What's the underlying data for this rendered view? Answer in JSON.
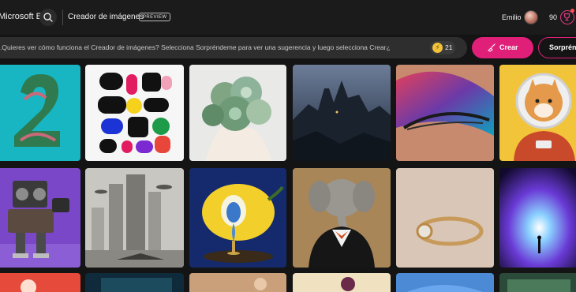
{
  "header": {
    "brand": "Microsoft Bing",
    "search_icon": "search-icon",
    "app_title": "Creador de imágenes",
    "badge": "PREVIEW",
    "user_name": "Emilio",
    "points": "90",
    "rewards_icon": "rewards-trophy-icon"
  },
  "prompt": {
    "placeholder": "¿Quieres ver cómo funciona el Creador de imágenes? Selecciona Sorpréndeme para ver una sugerencia y luego selecciona Crear.",
    "boosts": "21",
    "boost_icon": "boost-bolt-icon"
  },
  "actions": {
    "create_label": "Crear",
    "create_icon": "brush-icon",
    "surprise_label": "Sorpréndeme"
  },
  "colors": {
    "accent": "#e01f79",
    "background": "#141414",
    "boost": "#f3c13a"
  }
}
